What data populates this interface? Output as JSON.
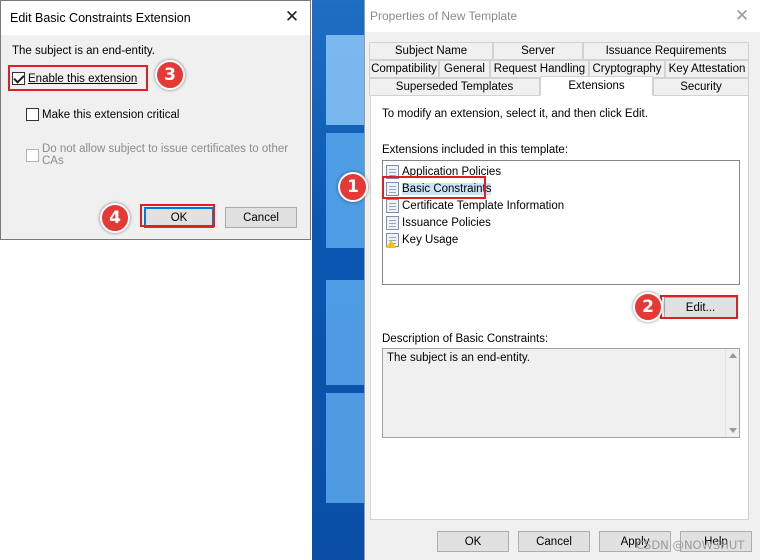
{
  "left_dialog": {
    "title": "Edit Basic Constraints Extension",
    "subject_text": "The subject is an end-entity.",
    "enable_label": "Enable this extension",
    "enable_checked": true,
    "critical_label": "Make this extension critical",
    "critical_checked": false,
    "no_issue_label": "Do not allow subject to issue certificates to other CAs",
    "no_issue_checked": false,
    "ok_label": "OK",
    "cancel_label": "Cancel"
  },
  "right_dialog": {
    "title": "Properties of New Template",
    "tabs_row1": [
      "Subject Name",
      "Server",
      "Issuance Requirements"
    ],
    "tabs_row2": [
      "Compatibility",
      "General",
      "Request Handling",
      "Cryptography",
      "Key Attestation"
    ],
    "tabs_row3": [
      "Superseded Templates",
      "Extensions",
      "Security"
    ],
    "active_tab": "Extensions",
    "instruction": "To modify an extension, select it, and then click Edit.",
    "list_label": "Extensions included in this template:",
    "extensions": [
      {
        "label": "Application Policies",
        "icon": "document-icon"
      },
      {
        "label": "Basic Constraints",
        "icon": "document-icon"
      },
      {
        "label": "Certificate Template Information",
        "icon": "document-icon"
      },
      {
        "label": "Issuance Policies",
        "icon": "document-icon"
      },
      {
        "label": "Key Usage",
        "icon": "warning-document-icon"
      }
    ],
    "selected_extension": "Basic Constraints",
    "edit_label": "Edit...",
    "desc_label": "Description of Basic Constraints:",
    "desc_text": "The subject is an end-entity.",
    "ok_label": "OK",
    "cancel_label": "Cancel",
    "apply_label": "Apply",
    "help_label": "Help"
  },
  "annotations": {
    "step1": "1",
    "step2": "2",
    "step3": "3",
    "step4": "4",
    "highlight_color": "#e02020"
  },
  "watermark": "CSDN @NOWSHUT"
}
